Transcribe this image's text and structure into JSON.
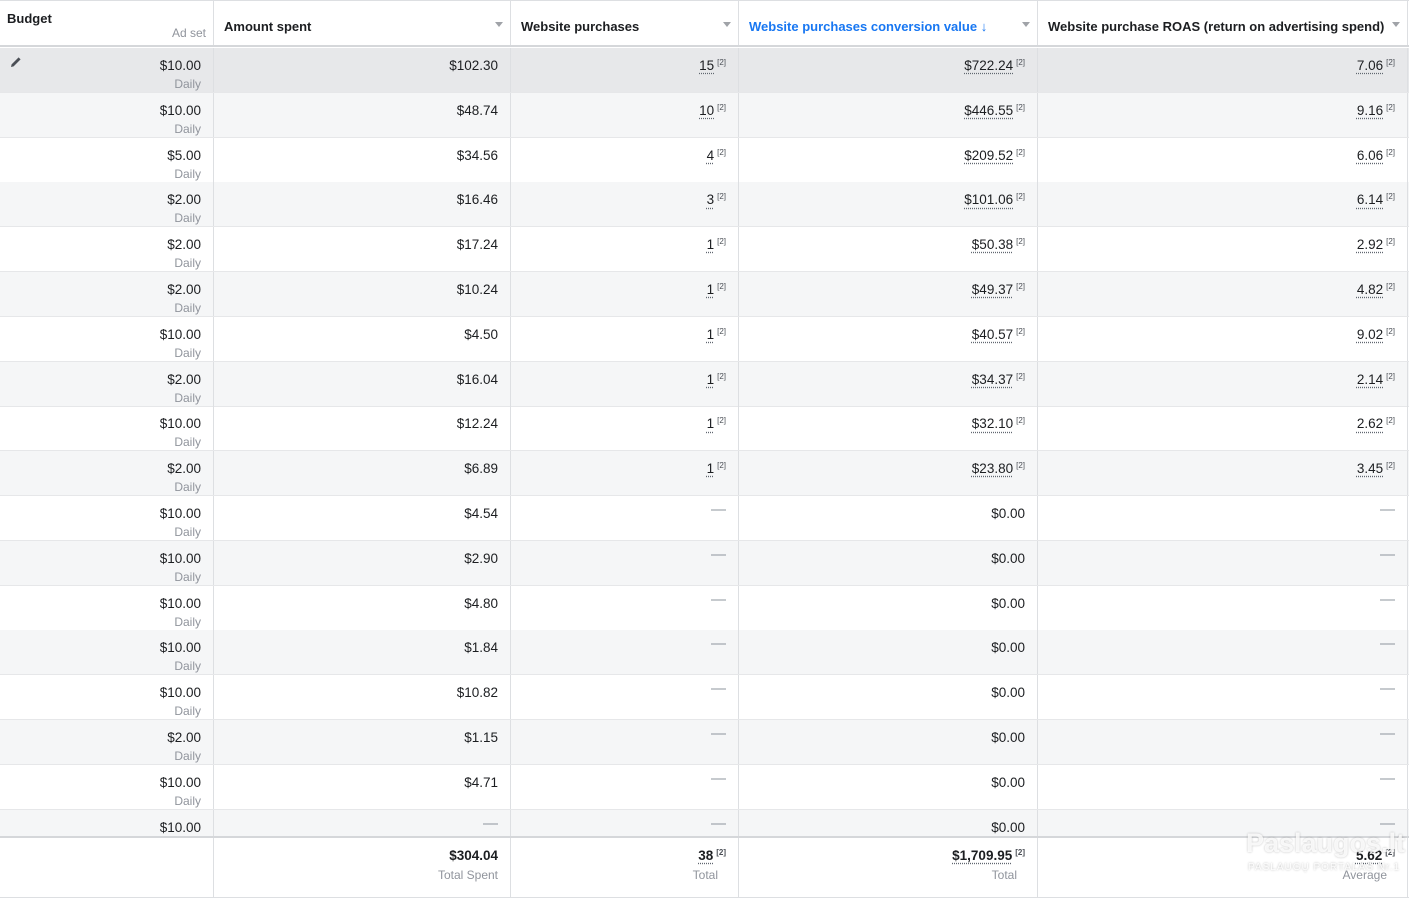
{
  "header": {
    "budget": "Budget",
    "adset": "Ad set",
    "amount_spent": "Amount spent",
    "website_purchases": "Website purchases",
    "conversion_value": "Website purchases conversion value",
    "sort_arrow": "↓",
    "roas": "Website purchase ROAS (return on advertising spend)"
  },
  "dash": "—",
  "info_marker": "[2]",
  "rows": [
    {
      "budget": "$10.00",
      "period": "Daily",
      "spent": "$102.30",
      "purchases": "15",
      "value": "$722.24",
      "roas": "7.06"
    },
    {
      "budget": "$10.00",
      "period": "Daily",
      "spent": "$48.74",
      "purchases": "10",
      "value": "$446.55",
      "roas": "9.16"
    },
    {
      "budget": "$5.00",
      "period": "Daily",
      "spent": "$34.56",
      "purchases": "4",
      "value": "$209.52",
      "roas": "6.06"
    },
    {
      "budget": "$2.00",
      "period": "Daily",
      "spent": "$16.46",
      "purchases": "3",
      "value": "$101.06",
      "roas": "6.14"
    },
    {
      "budget": "$2.00",
      "period": "Daily",
      "spent": "$17.24",
      "purchases": "1",
      "value": "$50.38",
      "roas": "2.92"
    },
    {
      "budget": "$2.00",
      "period": "Daily",
      "spent": "$10.24",
      "purchases": "1",
      "value": "$49.37",
      "roas": "4.82"
    },
    {
      "budget": "$10.00",
      "period": "Daily",
      "spent": "$4.50",
      "purchases": "1",
      "value": "$40.57",
      "roas": "9.02"
    },
    {
      "budget": "$2.00",
      "period": "Daily",
      "spent": "$16.04",
      "purchases": "1",
      "value": "$34.37",
      "roas": "2.14"
    },
    {
      "budget": "$10.00",
      "period": "Daily",
      "spent": "$12.24",
      "purchases": "1",
      "value": "$32.10",
      "roas": "2.62"
    },
    {
      "budget": "$2.00",
      "period": "Daily",
      "spent": "$6.89",
      "purchases": "1",
      "value": "$23.80",
      "roas": "3.45"
    },
    {
      "budget": "$10.00",
      "period": "Daily",
      "spent": "$4.54",
      "purchases": "",
      "value": "$0.00",
      "roas": ""
    },
    {
      "budget": "$10.00",
      "period": "Daily",
      "spent": "$2.90",
      "purchases": "",
      "value": "$0.00",
      "roas": ""
    },
    {
      "budget": "$10.00",
      "period": "Daily",
      "spent": "$4.80",
      "purchases": "",
      "value": "$0.00",
      "roas": ""
    },
    {
      "budget": "$10.00",
      "period": "Daily",
      "spent": "$1.84",
      "purchases": "",
      "value": "$0.00",
      "roas": ""
    },
    {
      "budget": "$10.00",
      "period": "Daily",
      "spent": "$10.82",
      "purchases": "",
      "value": "$0.00",
      "roas": ""
    },
    {
      "budget": "$2.00",
      "period": "Daily",
      "spent": "$1.15",
      "purchases": "",
      "value": "$0.00",
      "roas": ""
    },
    {
      "budget": "$10.00",
      "period": "Daily",
      "spent": "$4.71",
      "purchases": "",
      "value": "$0.00",
      "roas": ""
    },
    {
      "budget": "$10.00",
      "period": "",
      "spent": "",
      "purchases": "",
      "value": "$0.00",
      "roas": ""
    }
  ],
  "totals": {
    "spent": "$304.04",
    "spent_label": "Total Spent",
    "purchases": "38",
    "purchases_label": "Total",
    "value": "$1,709.95",
    "value_label": "Total",
    "roas": "5.62",
    "roas_label": "Average"
  },
  "watermark": {
    "brand": "Paslaugos.lt",
    "tagline": "PASLAUGŲ PORTALAS Nr.1"
  }
}
